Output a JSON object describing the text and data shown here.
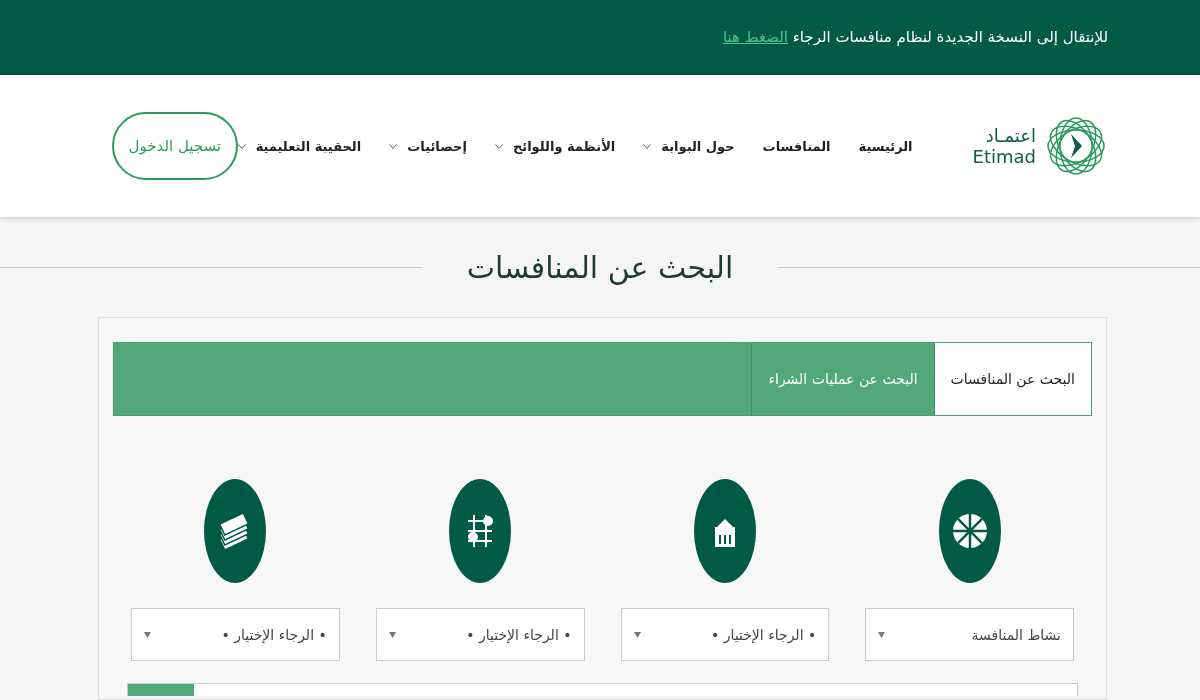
{
  "banner": {
    "text": "للإنتقال إلى النسخة الجديدة لنظام منافسات الرجاء",
    "link": "الضغط هنا"
  },
  "logo": {
    "arabic": "اعتمـاد",
    "latin": "Etimad"
  },
  "nav": [
    {
      "label": "الرئيسية",
      "dropdown": false
    },
    {
      "label": "المنافسات",
      "dropdown": false
    },
    {
      "label": "حول البوابة",
      "dropdown": true
    },
    {
      "label": "الأنظمة واللوائح",
      "dropdown": true
    },
    {
      "label": "إحصائيات",
      "dropdown": true
    },
    {
      "label": "الحقيبة التعليمية",
      "dropdown": true
    }
  ],
  "login_button": "تسجيل الدخول",
  "page_title": "البحث عن المنافسات",
  "tabs": [
    {
      "label": "البحث عن المنافسات",
      "selected": true
    },
    {
      "label": "البحث عن عمليات الشراء",
      "selected": false
    }
  ],
  "filters": [
    {
      "kind": "pie",
      "value": "نشاط المنافسة"
    },
    {
      "kind": "building",
      "value": "• الرجاء الإختيار •"
    },
    {
      "kind": "map",
      "value": "• الرجاء الإختيار •"
    },
    {
      "kind": "money",
      "value": "• الرجاء الإختيار •"
    }
  ]
}
